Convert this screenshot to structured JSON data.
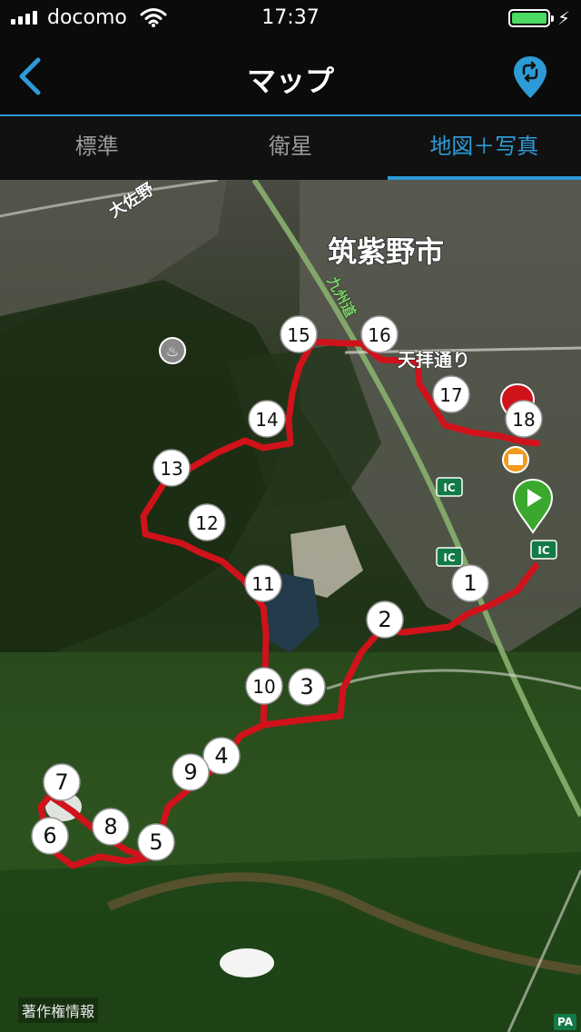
{
  "status": {
    "carrier": "docomo",
    "time": "17:37"
  },
  "nav": {
    "title": "マップ",
    "back_icon": "chevron-left-icon",
    "route_icon": "route-pin-icon"
  },
  "tabs": [
    {
      "label": "標準",
      "active": false
    },
    {
      "label": "衛星",
      "active": false
    },
    {
      "label": "地図＋写真",
      "active": true
    }
  ],
  "map": {
    "city_label": "筑紫野市",
    "road_label_1": "天拝通り",
    "road_label_2": "九州道",
    "road_label_3": "大佐野",
    "ic_badge": "IC",
    "pa_badge": "PA",
    "copyright": "著作権情報",
    "route_color": "#d0121b",
    "waypoints": [
      "1",
      "2",
      "3",
      "4",
      "5",
      "6",
      "7",
      "8",
      "9",
      "10",
      "11",
      "12",
      "13",
      "14",
      "15",
      "16",
      "17",
      "18"
    ]
  }
}
